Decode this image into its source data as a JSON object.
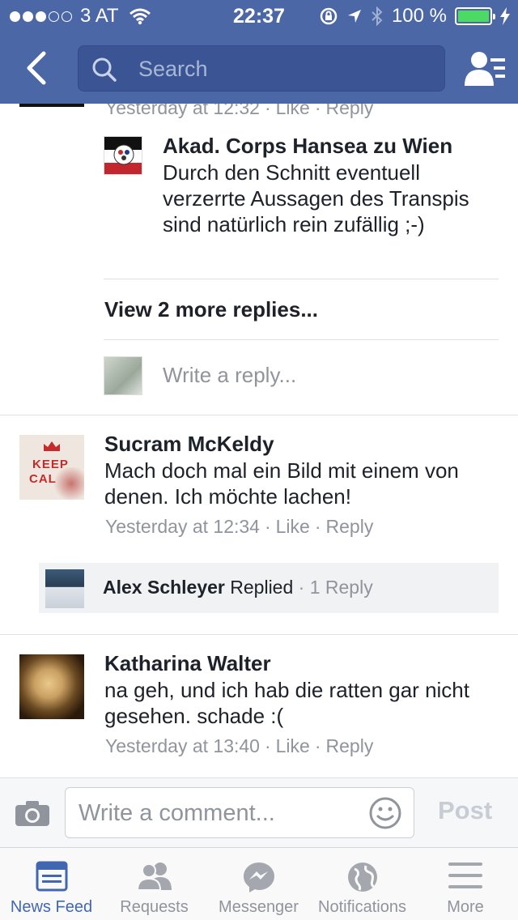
{
  "status_bar": {
    "carrier": "3 AT",
    "time": "22:37",
    "battery": "100 %",
    "battery_level": 1.0
  },
  "header": {
    "search_placeholder": "Search"
  },
  "thread": {
    "previous_meta": {
      "time": "Yesterday at 12:32",
      "like": "Like",
      "reply": "Reply"
    },
    "reply": {
      "author": "Akad. Corps Hansea zu Wien",
      "text": "Durch den Schnitt eventuell verzerrte Aussagen des Transpis sind natürlich rein zufällig ;-)"
    },
    "view_more": "View 2 more replies...",
    "write_reply_placeholder": "Write a reply..."
  },
  "comments": [
    {
      "author": "Sucram McKeldy",
      "avatar_text_1": "KEEP",
      "avatar_text_2": "CAL",
      "text": "Mach doch mal ein Bild mit einem von denen. Ich möchte lachen!",
      "time": "Yesterday at 12:34",
      "like": "Like",
      "reply": "Reply",
      "replied": {
        "author": "Alex Schleyer",
        "label": "Replied",
        "count": "1 Reply"
      }
    },
    {
      "author": "Katharina Walter",
      "text": "na geh, und ich hab die ratten gar nicht gesehen. schade :(",
      "time": "Yesterday at 13:40",
      "like": "Like",
      "reply": "Reply"
    }
  ],
  "composer": {
    "placeholder": "Write a comment...",
    "post_label": "Post"
  },
  "tabs": [
    {
      "label": "News Feed",
      "icon": "news-feed-icon",
      "active": true
    },
    {
      "label": "Requests",
      "icon": "friend-requests-icon",
      "active": false
    },
    {
      "label": "Messenger",
      "icon": "messenger-icon",
      "active": false
    },
    {
      "label": "Notifications",
      "icon": "globe-icon",
      "active": false
    },
    {
      "label": "More",
      "icon": "menu-icon",
      "active": false
    }
  ],
  "colors": {
    "brand_blue": "#4b67a5",
    "active_tab": "#4267b2",
    "muted_text": "#90949c",
    "battery_green": "#4cd964"
  }
}
